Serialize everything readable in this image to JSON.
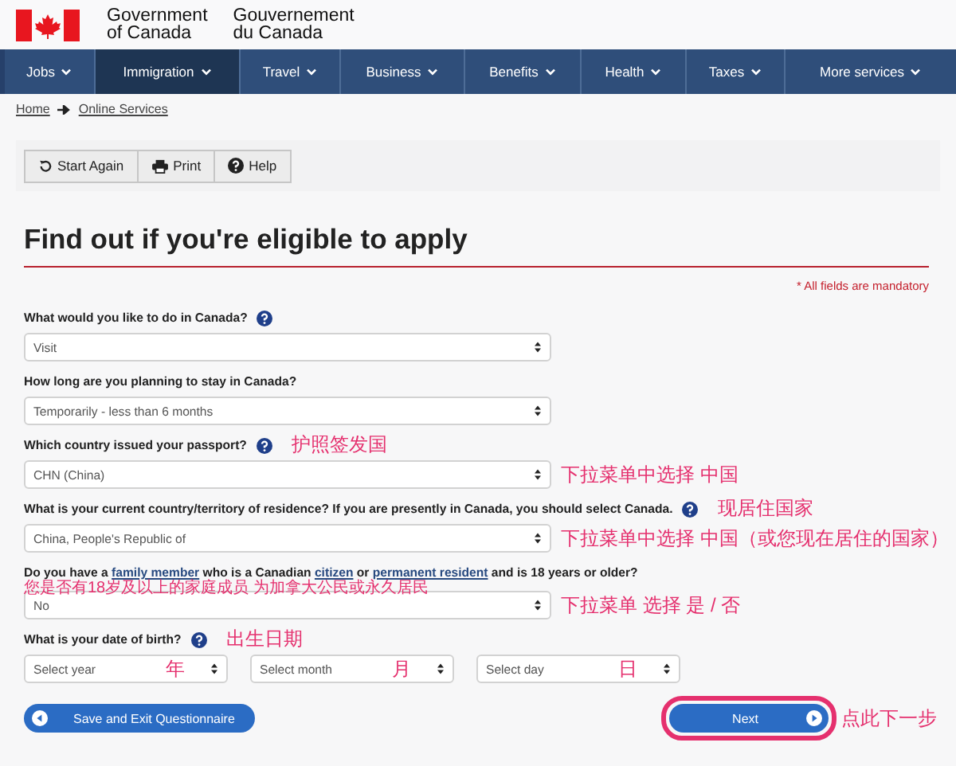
{
  "header": {
    "english": [
      "Government",
      "of Canada"
    ],
    "french": [
      "Gouvernement",
      "du Canada"
    ]
  },
  "nav": [
    {
      "label": "Jobs",
      "selected": false
    },
    {
      "label": "Immigration",
      "selected": true
    },
    {
      "label": "Travel",
      "selected": false
    },
    {
      "label": "Business",
      "selected": false
    },
    {
      "label": "Benefits",
      "selected": false
    },
    {
      "label": "Health",
      "selected": false
    },
    {
      "label": "Taxes",
      "selected": false
    },
    {
      "label": "More services",
      "selected": false
    }
  ],
  "breadcrumb": [
    "Home",
    "Online Services"
  ],
  "toolbar": [
    {
      "label": "Start Again",
      "kind": "restart"
    },
    {
      "label": "Print",
      "kind": "print"
    },
    {
      "label": "Help",
      "kind": "help"
    }
  ],
  "title": "Find out if you're eligible to apply",
  "mandatory_note": "* All fields are mandatory",
  "questions": [
    {
      "kind": "select",
      "label": [
        {
          "text": "What would you like to do in Canada?",
          "link": false
        }
      ],
      "help": true,
      "value": "Visit"
    },
    {
      "kind": "select",
      "label": [
        {
          "text": "How long are you planning to stay in Canada?",
          "link": false
        }
      ],
      "help": false,
      "value": "Temporarily - less than 6 months"
    },
    {
      "kind": "select",
      "label": [
        {
          "text": "Which country issued your passport?",
          "link": false
        }
      ],
      "help": true,
      "note": "护照签发国",
      "value": "CHN (China)",
      "field_note": "下拉菜单中选择 中国"
    },
    {
      "kind": "select",
      "label": [
        {
          "text": "What is your current country/territory of residence? If you are presently in Canada, you should select Canada.",
          "link": false
        }
      ],
      "help": true,
      "note": "现居住国家",
      "value": "China, People's Republic of",
      "field_note": "下拉菜单中选择 中国（或您现在居住的国家）"
    },
    {
      "kind": "select",
      "label": [
        {
          "text": "Do you have a",
          "link": false
        },
        {
          "text": "family member",
          "link": true
        },
        {
          "text": "who is a Canadian",
          "link": false
        },
        {
          "text": "citizen",
          "link": true
        },
        {
          "text": "or",
          "link": false
        },
        {
          "text": "permanent resident",
          "link": true
        },
        {
          "text": "and is 18 years or older?",
          "link": false
        }
      ],
      "help": false,
      "sub_note": "您是否有18岁及以上的家庭成员 为加拿大公民或永久居民",
      "value": "No",
      "field_note": "下拉菜单 选择 是 / 否"
    },
    {
      "kind": "date",
      "label": [
        {
          "text": "What is your date of birth?",
          "link": false
        }
      ],
      "help": true,
      "note": "出生日期",
      "parts": [
        {
          "placeholder": "Select year",
          "note": "年"
        },
        {
          "placeholder": "Select month",
          "note": "月"
        },
        {
          "placeholder": "Select day",
          "note": "日"
        }
      ]
    }
  ],
  "buttons": [
    {
      "label": "Save and Exit Questionnaire",
      "kind": "back",
      "highlighted": false
    },
    {
      "label": "Next",
      "kind": "next",
      "highlighted": true,
      "note": "点此下一步"
    }
  ]
}
